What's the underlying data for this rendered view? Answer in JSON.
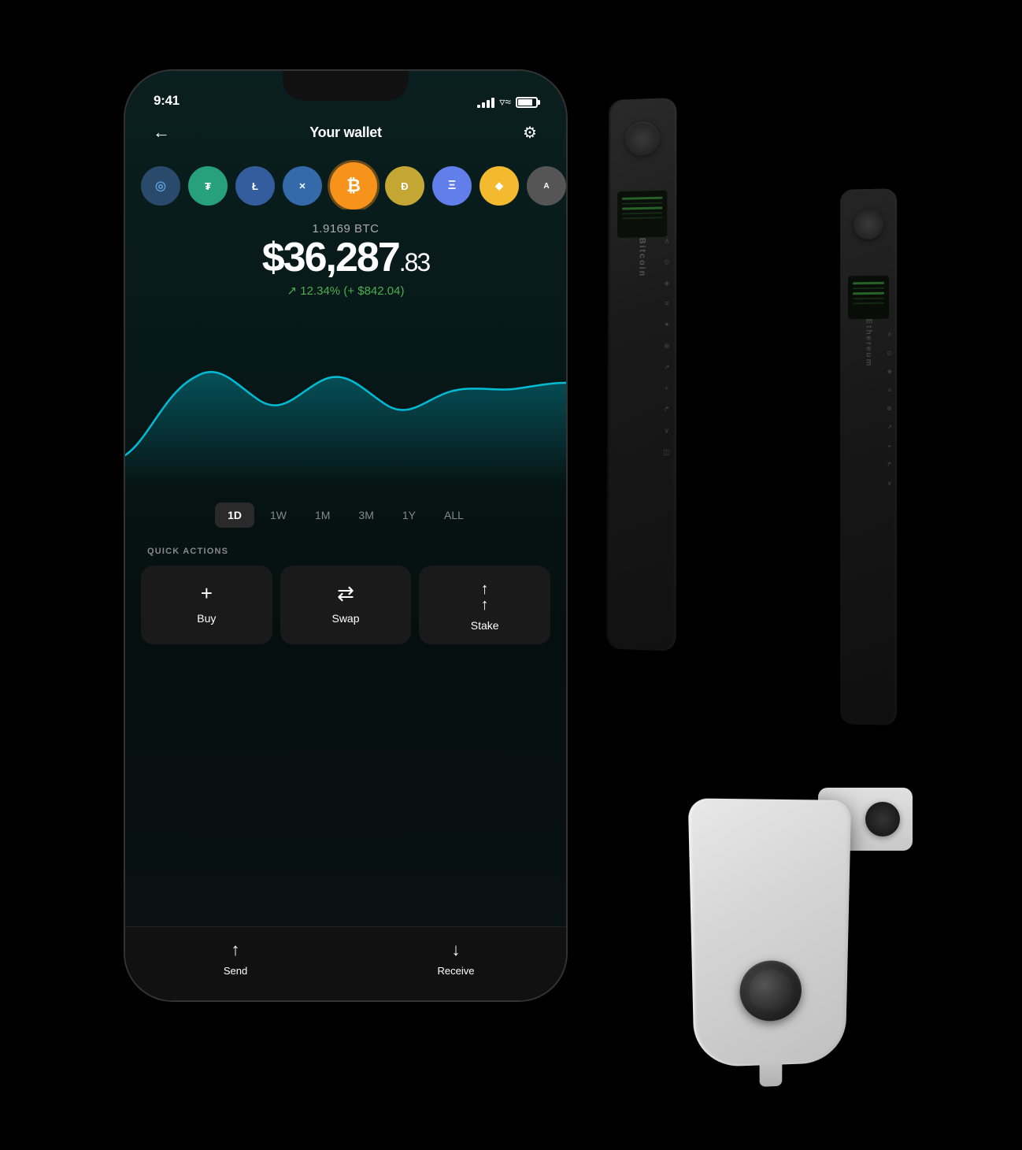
{
  "app": {
    "background": "#000"
  },
  "statusBar": {
    "time": "9:41",
    "batteryLevel": "80%"
  },
  "header": {
    "title": "Your wallet",
    "backLabel": "←",
    "settingsLabel": "⚙"
  },
  "coins": [
    {
      "id": "other",
      "symbol": "◎",
      "cssClass": "coin-other"
    },
    {
      "id": "tether",
      "symbol": "₮",
      "cssClass": "coin-tether"
    },
    {
      "id": "litecoin",
      "symbol": "Ł",
      "cssClass": "coin-ltc"
    },
    {
      "id": "xrp",
      "symbol": "✕",
      "cssClass": "coin-xrp"
    },
    {
      "id": "bitcoin",
      "symbol": "₿",
      "cssClass": "coin-btc",
      "active": true
    },
    {
      "id": "dogecoin",
      "symbol": "Ð",
      "cssClass": "coin-doge"
    },
    {
      "id": "ethereum",
      "symbol": "Ξ",
      "cssClass": "coin-eth"
    },
    {
      "id": "bnb",
      "symbol": "◆",
      "cssClass": "coin-bnb"
    },
    {
      "id": "algo",
      "symbol": "A",
      "cssClass": "coin-algo"
    }
  ],
  "balance": {
    "crypto": "1.9169 BTC",
    "fiatMain": "$36,287",
    "fiatCents": ".83",
    "changePercent": "↗ 12.34%",
    "changeAmount": "(+ $842.04)",
    "changeColor": "#4CAF50"
  },
  "chart": {
    "color": "#00BCD4",
    "gradientStart": "rgba(0,188,212,0.3)",
    "gradientEnd": "rgba(0,188,212,0)"
  },
  "timePeriods": [
    {
      "label": "1D",
      "active": true
    },
    {
      "label": "1W",
      "active": false
    },
    {
      "label": "1M",
      "active": false
    },
    {
      "label": "3M",
      "active": false
    },
    {
      "label": "1Y",
      "active": false
    },
    {
      "label": "ALL",
      "active": false
    }
  ],
  "quickActions": {
    "sectionLabel": "QUICK ACTIONS",
    "buttons": [
      {
        "id": "buy",
        "icon": "+",
        "label": "Buy"
      },
      {
        "id": "swap",
        "icon": "⇄",
        "label": "Swap"
      },
      {
        "id": "stake",
        "icon": "↑↑",
        "label": "Stake"
      }
    ]
  },
  "bottomBar": {
    "buttons": [
      {
        "id": "send",
        "icon": "↑",
        "label": "Send"
      },
      {
        "id": "receive",
        "icon": "↓",
        "label": "Receive"
      }
    ]
  },
  "devices": {
    "nanoX1": {
      "model": "Nano X",
      "text": "Bitcoin"
    },
    "nanoX2": {
      "model": "Nano X",
      "text": "Ethereum"
    },
    "nanoS": {
      "model": "Nano S",
      "color": "white"
    }
  }
}
